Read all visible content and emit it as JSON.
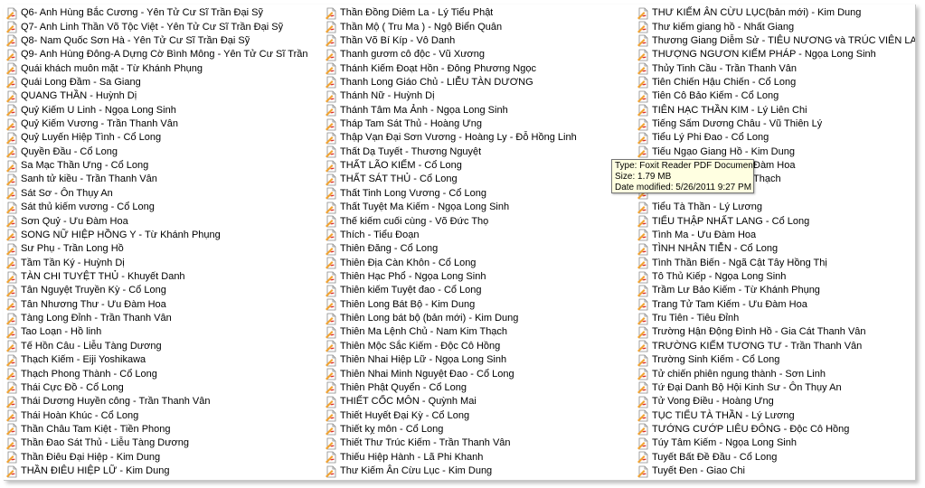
{
  "colors": {
    "icon_page": "#ffffff",
    "icon_border": "#8a8a8a",
    "icon_accent_red": "#d9302a",
    "icon_accent_orange": "#f1a332",
    "tooltip_bg": "#ffffe1"
  },
  "icon": "pdf-file-icon",
  "columns": [
    [
      "Q6- Anh Hùng Bắc Cương - Yên Tử Cư Sĩ Trần Đại Sỹ",
      "Q7- Anh Linh Thần Võ Tộc Việt - Yên Tử Cư Sĩ Trần Đại Sỹ",
      "Q8- Nam Quốc Sơn Hà - Yên Tử Cư Sĩ Trần Đại Sỹ",
      "Q9- Anh Hùng Đông-A Dựng Cờ Bình Mông - Yên Tử Cư Sĩ Trần Đại Sỹ",
      "Quái khách muôn mặt - Từ Khánh Phụng",
      "Quái Long Đầm - Sa Giang",
      "QUANG THẦN - Huỳnh Dị",
      "Quỷ Kiếm U Linh - Ngọa Long Sinh",
      "Quỷ Kiếm Vương - Trần Thanh Vân",
      "Quỷ Luyến Hiệp Tình - Cổ Long",
      "Quyền Đầu - Cổ Long",
      "Sa Mạc Thần Ưng - Cổ Long",
      "Sanh tử kiều - Trần Thanh Vân",
      "Sát Sơ - Ôn Thụy An",
      "Sát thủ kiếm vương - Cổ Long",
      "Sơn Quỷ - Ưu Đàm Hoa",
      "SONG NỮ HIỆP HỒNG Y - Từ Khánh Phụng",
      "Sư Phụ - Trần Long Hồ",
      "Tầm Tần Ký - Huỳnh Dị",
      "TÀN CHI TUYỆT THỦ - Khuyết Danh",
      "Tân Nguyệt Truyền Kỳ - Cổ Long",
      "Tân Nhương Thư - Ưu Đàm Hoa",
      "Tàng Long Đỉnh - Trần Thanh Vân",
      "Tao Loạn - Hồ linh",
      "Tế Hồn Câu - Liễu Tàng Dương",
      "Thạch Kiếm - Eiji Yoshikawa",
      "Thạch Phong Thành - Cổ Long",
      "Thái Cực Đồ - Cổ Long",
      "Thái Dương Huyền công - Trần Thanh Vân",
      "Thái Hoàn Khúc - Cổ Long",
      "Thần Châu Tam Kiệt - Tiền Phong",
      "Thần Đao Sát Thủ - Liễu Tàng Dương",
      "Thần Điêu Đại Hiệp - Kim Dung",
      "THẦN ĐIÊU HIỆP LỮ - Kim Dung"
    ],
    [
      "Thần Đồng Diêm La - Lý Tiểu Phật",
      "Thần Mộ ( Tru Ma ) - Ngộ Biển Quân",
      "Thần Võ Bí Kíp - Vô Danh",
      "Thanh gươm cô độc - Vũ Xương",
      "Thánh Kiếm Đoạt Hồn - Đông Phương Ngọc",
      "Thanh Long Giáo Chủ - LIỄU TÀN DƯƠNG",
      "Thánh Nữ - Huỳnh Dị",
      "Thánh Tâm Ma Ảnh - Ngọa Long Sinh",
      "Tháp Tam Sát Thủ - Hoàng Ưng",
      "Thập Vạn Đại Sơn Vương - Hoàng Ly - Đỗ Hồng Linh",
      "Thất Dạ Tuyết - Thương Nguyệt",
      "THẤT LÃO KIẾM - Cổ Long",
      "THẤT SÁT THỦ - Cổ Long",
      "Thất Tinh Long Vương - Cổ Long",
      "Thất Tuyệt Ma Kiếm - Ngọa Long Sinh",
      "Thế kiếm cuối cùng - Võ Đức Thọ",
      "Thích - Tiểu Đoạn",
      "Thiên Đăng - Cổ Long",
      "Thiên Địa Càn Khôn - Cổ Long",
      "Thiên Hạc Phổ - Ngọa Long Sinh",
      "Thiên kiếm Tuyệt đao - Cổ Long",
      "Thiên Long Bát Bộ - Kim Dung",
      "Thiên Long bát bộ (bản mới) - Kim Dung",
      "Thiên Ma Lệnh Chủ - Nam Kim Thạch",
      "Thiên Mộc Sắc Kiếm - Độc Cô Hồng",
      "Thiên Nhai Hiệp Lữ - Ngọa Long Sinh",
      "Thiên Nhai Minh Nguyệt Đao - Cổ Long",
      "Thiên Phật Quyển - Cổ Long",
      "THIẾT CỐC MÔN - Quỳnh Mai",
      "Thiết Huyết Đại Kỳ - Cổ Long",
      "Thiết kỵ môn - Cổ Long",
      "Thiết Thư Trúc Kiếm - Trần Thanh Vân",
      "Thiếu Hiệp Hành - Lã Phi Khanh",
      "Thư Kiếm Ân Cừu Lục - Kim Dung"
    ],
    [
      "THƯ KIẾM ÂN CỪU LỤC(bản mới) - Kim Dung",
      "Thư kiếm giang hồ - Nhất Giang",
      "Thương Giang Diễm Sử - TIÊU NƯƠNG và TRÚC VIÊN LANG (Bùi Văn",
      "THƯỢNG NGƯƠN KIẾM PHÁP - Ngọa Long Sinh",
      "Thủy Tinh Cầu - Trần Thanh Vân",
      "Tiên Chiến Hậu Chiến - Cổ Long",
      "Tiên Cô Bảo Kiếm - Cổ Long",
      "TIÊN HẠC THẦN KIM - Lý Liên Chi",
      "Tiếng Sấm Dương Châu - Vũ Thiên Lý",
      "Tiểu Lý Phi Đao - Cổ Long",
      "Tiếu Ngạo Giang Hồ - Kim Dung",
      "",
      "",
      "",
      "Tiểu Tà Thần - Lý Lương",
      "TIỂU THẬP NHẤT LANG - Cổ Long",
      "Tình Ma - Ưu Đàm Hoa",
      "TÌNH NHÂN TIỄN - Cổ Long",
      "Tình Thần Biến - Ngã Cật Tây Hồng Thị",
      "Tô Thủ Kiếp - Ngọa Long Sinh",
      "Trầm Lư Bảo Kiếm - Từ Khánh Phụng",
      "Trang Tử Tam Kiếm - Ưu Đàm Hoa",
      "Tru Tiên - Tiêu Đỉnh",
      "Trường Hận Động Đình Hồ - Gia Cát Thanh Vân",
      "TRƯỜNG KIẾM TƯƠNG TƯ - Trần Thanh Vân",
      "Trường Sinh Kiếm - Cổ Long",
      "Tử chiến phiên ngung thành - Sơn Linh",
      "Tứ Đại Danh Bộ Hội Kinh Sư - Ôn Thụy An",
      "Tử Vong Điều - Hoàng Ưng",
      "TỤC TIỂU TÀ THẦN - Lý Lương",
      "TƯỚNG CƯỚP LIÊU ĐÔNG - Độc Cô Hồng",
      "Túy Tâm Kiếm - Ngọa Long Sinh",
      "Tuyết Bất Đề Đầu - Cổ Long",
      "Tuyết Đen - Giao Chi"
    ]
  ],
  "partial_rows": {
    "row_11": "Đàm Hoa",
    "row_12": "Thạch"
  },
  "tooltip": {
    "type": "Type: Foxit Reader PDF Document",
    "size": "Size: 1.79 MB",
    "modified": "Date modified: 5/26/2011 9:27 PM"
  }
}
